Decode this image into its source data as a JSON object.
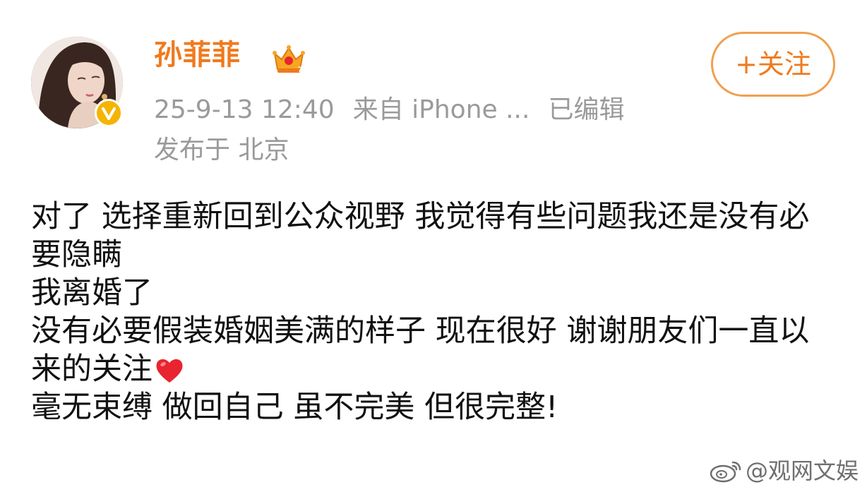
{
  "user": {
    "name": "孙菲菲",
    "crown_icon": "crown-icon",
    "verified_icon": "verified-badge-icon",
    "avatar_icon": "avatar"
  },
  "meta": {
    "timestamp": "25-9-13 12:40",
    "source": "来自 iPhone ...",
    "edited": "已编辑",
    "location": "发布于 北京"
  },
  "follow": {
    "label": "+关注"
  },
  "post": {
    "lines": [
      "对了 选择重新回到公众视野 我觉得有些问题我还是没有必要隐瞒",
      "我离婚了",
      "没有必要假装婚姻美满的样子 现在很好 谢谢朋友们一直以来的关注",
      "毫无束缚 做回自己 虽不完美 但很完整!"
    ],
    "heart_icon": "heart-emoji-icon"
  },
  "watermark": {
    "text": "@观网文娱",
    "icon": "weibo-icon"
  },
  "colors": {
    "name": "#f07a1e",
    "meta": "#9a9a9a",
    "follow_border": "#f0a050",
    "body": "#111111",
    "verified": "#f5b400",
    "heart": "#e8242f"
  }
}
